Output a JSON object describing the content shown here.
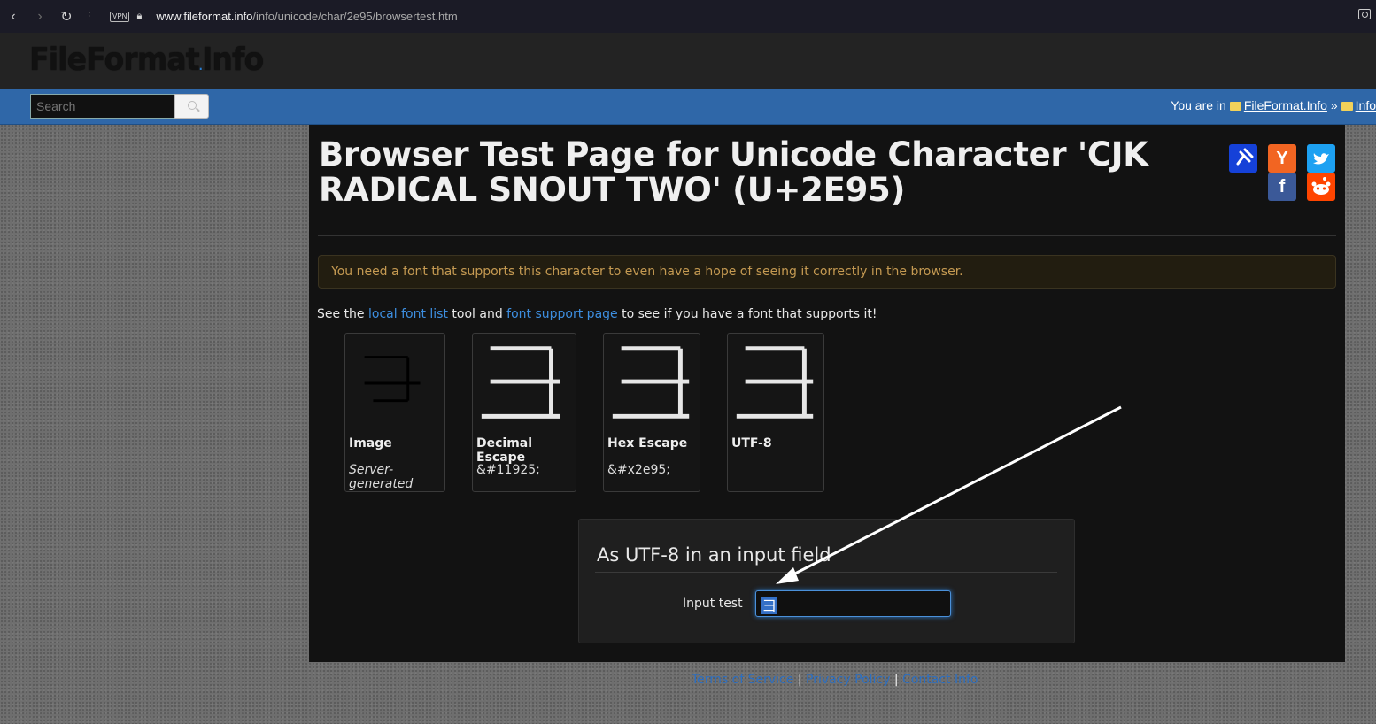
{
  "browser": {
    "url_host": "www.fileformat.info",
    "url_path": "/info/unicode/char/2e95/browsertest.htm",
    "vpn_label": "VPN"
  },
  "site": {
    "logo": "FileFormat",
    "logo_tail": "Info",
    "search_placeholder": "Search",
    "breadcrumb_prefix": "You are in",
    "breadcrumb_items": [
      "FileFormat.Info",
      "Info"
    ],
    "breadcrumb_sep": "»"
  },
  "page": {
    "title": "Browser Test Page for Unicode Character 'CJK RADICAL SNOUT TWO' (U+2E95)",
    "alert": "You need a font that supports this character to even have a hope of seeing it correctly in the browser.",
    "see_prefix": "See the",
    "local_font_link": "local font list",
    "see_mid": "tool and",
    "font_support_link": "font support page",
    "see_suffix": "to see if you have a font that supports it!"
  },
  "social": {
    "pin_icon": "pin-icon",
    "hn_label": "Y",
    "tw_icon": "twitter-icon",
    "fb_label": "f",
    "rd_icon": "reddit-icon"
  },
  "cards": [
    {
      "label": "Image",
      "sub": "Server-generated"
    },
    {
      "label": "Decimal Escape",
      "sub": "&#11925;"
    },
    {
      "label": "Hex Escape",
      "sub": "&#x2e95;"
    },
    {
      "label": "UTF-8",
      "sub": ""
    }
  ],
  "form": {
    "title": "As UTF-8 in an input field",
    "input_label": "Input test",
    "input_value": "⺕"
  },
  "footer": {
    "terms": "Terms of Service",
    "privacy": "Privacy Policy",
    "contact": "Contact Info",
    "sep": "|"
  }
}
